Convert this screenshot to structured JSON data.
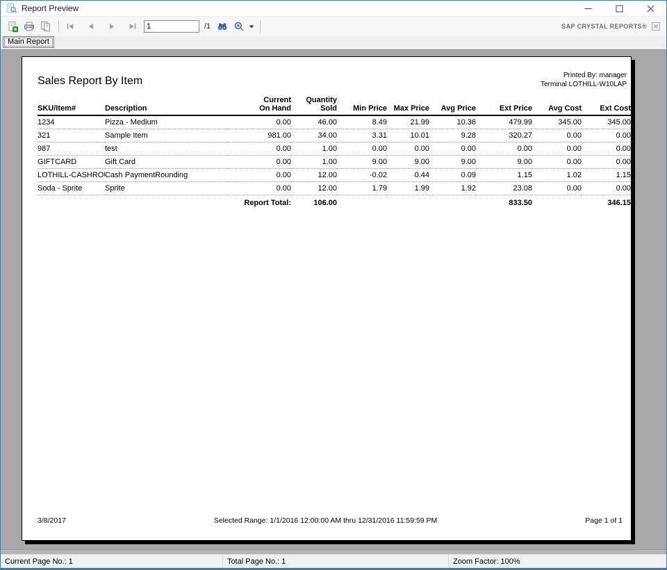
{
  "window": {
    "title": "Report Preview",
    "brand": "SAP CRYSTAL REPORTS®"
  },
  "toolbar": {
    "page_value": "1",
    "page_total_label": "/1"
  },
  "tab": {
    "label": "Main Report"
  },
  "report": {
    "title": "Sales Report By Item",
    "printed_by": "Printed By: manager",
    "terminal": "Terminal LOTHILL-W10LAP",
    "footer_date": "3/8/2017",
    "footer_range": "Selected Range: 1/1/2016 12:00:00 AM thru 12/31/2016 11:59:59 PM",
    "footer_page": "Page 1 of 1"
  },
  "table": {
    "headers": [
      "SKU/Item#",
      "Description",
      "Current\nOn Hand",
      "Quantity\nSold",
      "Min Price",
      "Max Price",
      "Avg Price",
      "Ext Price",
      "Avg Cost",
      "Ext Cost"
    ],
    "rows": [
      [
        "1234",
        "Pizza - Medium",
        "0.00",
        "46.00",
        "8.49",
        "21.99",
        "10.36",
        "479.99",
        "345.00",
        "345.00"
      ],
      [
        "321",
        "Sample Item",
        "981.00",
        "34.00",
        "3.31",
        "10.01",
        "9.28",
        "320.27",
        "0.00",
        "0.00"
      ],
      [
        "987",
        "test",
        "0.00",
        "1.00",
        "0.00",
        "0.00",
        "0.00",
        "0.00",
        "0.00",
        "0.00"
      ],
      [
        "GIFTCARD",
        "Gift Card",
        "0.00",
        "1.00",
        "9.00",
        "9.00",
        "9.00",
        "9.00",
        "0.00",
        "0.00"
      ],
      [
        "LOTHILL-CASHROU",
        "Cash PaymentRounding",
        "0.00",
        "12.00",
        "-0.02",
        "0.44",
        "0.09",
        "1.15",
        "1.02",
        "1.15"
      ],
      [
        "Soda - Sprite",
        "Sprite",
        "0.00",
        "12.00",
        "1.79",
        "1.99",
        "1.92",
        "23.08",
        "0.00",
        "0.00"
      ]
    ],
    "total_label": "Report Total:",
    "total_values": [
      "106.00",
      "",
      "",
      "",
      "833.50",
      "",
      "346.15"
    ]
  },
  "statusbar": {
    "current_page": "Current Page No.: 1",
    "total_page": "Total Page No.: 1",
    "zoom_factor": "Zoom Factor: 100%"
  },
  "icons": {
    "titlebar": "document-with-magnifier",
    "export": "document-with-green-box",
    "print": "printer",
    "copy": "two-documents",
    "first_page": "bar-left-triangle",
    "prev_page": "left-triangle",
    "next_page": "right-triangle",
    "last_page": "right-triangle-bar",
    "find": "binoculars",
    "zoom": "magnifier",
    "zoom_caret": "▾",
    "minimize": "–",
    "maximize": "□",
    "close": "✕",
    "dismiss_branding": "✕"
  },
  "colors": {
    "window_border": "#2e7fd4",
    "preview_background": "#a8a8a8",
    "export_green": "#3fa23f",
    "icon_blue": "#2d64ad",
    "magnifier_handle": "#c98b2e",
    "disabled_nav_gray": "#a0a0a0"
  }
}
